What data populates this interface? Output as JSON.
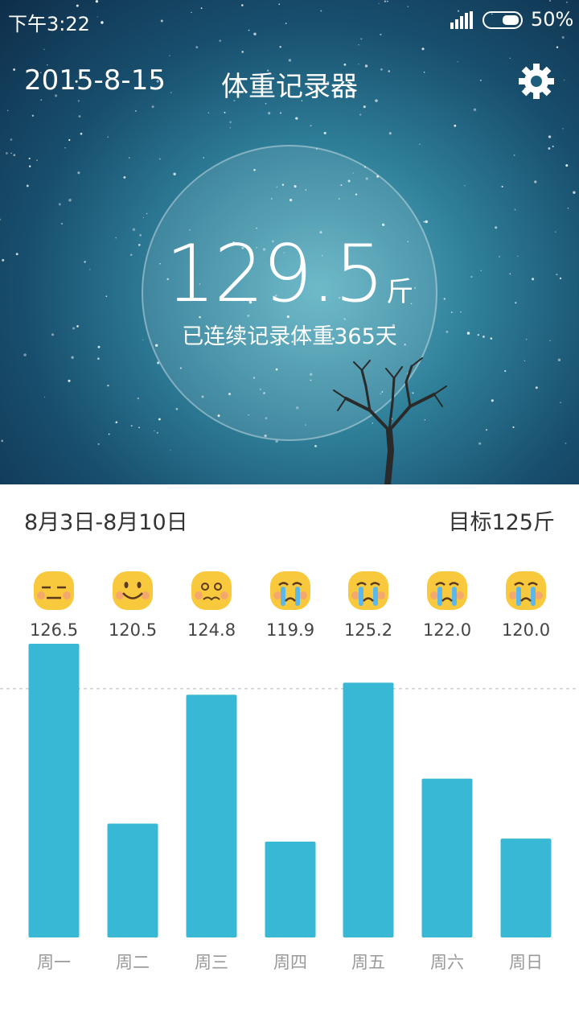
{
  "status_bar": {
    "time": "下午3:22",
    "battery": "50%"
  },
  "header": {
    "date": "2015-8-15",
    "title": "体重记录器"
  },
  "current": {
    "weight": "129.5",
    "unit": "斤",
    "streak_text": "已连续记录体重365天"
  },
  "summary": {
    "range": "8月3日-8月10日",
    "goal_text": "目标125斤"
  },
  "colors": {
    "bar": "#38b8d4",
    "goal_line": "#bbbbbb",
    "emoji_face": "#f9c93d"
  },
  "chart_data": {
    "type": "bar",
    "categories": [
      "周一",
      "周二",
      "周三",
      "周四",
      "周五",
      "周六",
      "周日"
    ],
    "values": [
      126.5,
      120.5,
      124.8,
      119.9,
      125.2,
      122.0,
      120.0
    ],
    "value_labels": [
      "126.5",
      "120.5",
      "124.8",
      "119.9",
      "125.2",
      "122.0",
      "120.0"
    ],
    "moods": [
      "expressionless-face",
      "smiling-face",
      "worried-face",
      "crying-face",
      "crying-face",
      "crying-face",
      "crying-face"
    ],
    "goal": 125,
    "ylim": [
      116.7,
      126.5
    ]
  }
}
